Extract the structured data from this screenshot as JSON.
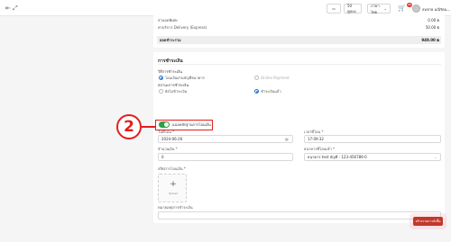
{
  "header": {
    "left_icon_1": "fullscreen-icon",
    "left_icon_2": "grid-icon",
    "card_label": "▭",
    "points_label": "50 คูปอง",
    "lang_label": "ภาษาไทย",
    "cart_badge": "99",
    "user_name": "สมชาย มณีรัตน..."
  },
  "summary": {
    "rows": [
      {
        "label": "ส่วนลดพิเศษ",
        "value": "0.00 ฿"
      },
      {
        "label": "ค่าบริการ Delivery (Express)",
        "value": "50.00 ฿"
      }
    ],
    "total_label": "ยอดชำระรวม",
    "total_value": "949.00 ฿"
  },
  "payment": {
    "section_title": "การชำระเงิน",
    "method_title": "วิธีการชำระเงิน",
    "method_options": [
      "โอนเงินผ่านบัญชีธนาคาร",
      "Online Payment"
    ],
    "status_title": "สถานะการชำระเงิน",
    "status_options": [
      "ยังไม่ชำระเงิน",
      "ชำระเงินแล้ว"
    ],
    "toggle_label": "แนบหลักฐานการโอนเงิน",
    "toggle_on": true,
    "step_number": "2",
    "date_label": "วันที่โอน *",
    "date_value": "2024-06-26",
    "time_label": "เวลาที่โอน *",
    "time_value": "17:09:32",
    "amount_label": "จำนวนเงิน *",
    "amount_value": "0",
    "account_label": "ธนาคารที่โอนเข้า *",
    "account_value": "ธนาคาร test บัญชี - 123-456789-0",
    "slip_label": "สลิปการโอนเงิน *",
    "upload_label": "Upload",
    "note_label": "หมายเหตุการชำระเงิน",
    "note_value": "",
    "submit_label": "สร้างรายการสั่งซื้อ"
  }
}
